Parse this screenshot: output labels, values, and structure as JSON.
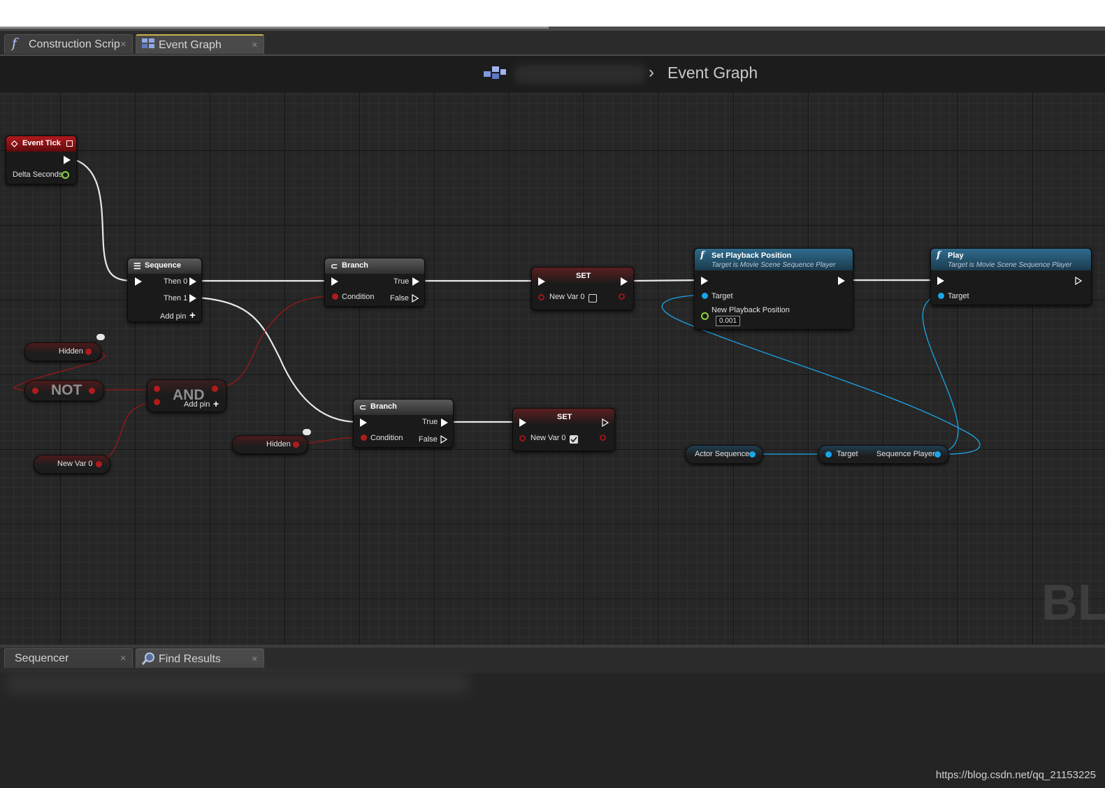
{
  "tabs": [
    {
      "label": "Construction Scrip",
      "icon": "function-icon"
    },
    {
      "label": "Event Graph",
      "icon": "event-graph-icon"
    }
  ],
  "breadcrumb": {
    "current": "Event Graph"
  },
  "nodes": {
    "event_tick": {
      "title": "Event Tick",
      "delta": "Delta Seconds"
    },
    "sequence": {
      "title": "Sequence",
      "then0": "Then 0",
      "then1": "Then 1",
      "add_pin": "Add pin"
    },
    "branch1": {
      "title": "Branch",
      "cond": "Condition",
      "true": "True",
      "false": "False"
    },
    "branch2": {
      "title": "Branch",
      "cond": "Condition",
      "true": "True",
      "false": "False"
    },
    "set1": {
      "title": "SET",
      "var": "New Var 0",
      "checked": false
    },
    "set2": {
      "title": "SET",
      "var": "New Var 0",
      "checked": true
    },
    "set_playback": {
      "title": "Set Playback Position",
      "subtitle": "Target is Movie Scene Sequence Player",
      "target": "Target",
      "new_pos": "New Playback Position",
      "value": "0.001"
    },
    "play": {
      "title": "Play",
      "subtitle": "Target is Movie Scene Sequence Player",
      "target": "Target"
    },
    "hidden1": {
      "label": "Hidden"
    },
    "hidden2": {
      "label": "Hidden"
    },
    "not_op": {
      "label": "NOT"
    },
    "and_op": {
      "label": "AND",
      "add_pin": "Add pin"
    },
    "newvar": {
      "label": "New Var 0"
    },
    "actor_seq": {
      "label": "Actor Sequence"
    },
    "seq_player": {
      "target": "Target",
      "output": "Sequence Player"
    }
  },
  "watermark": "BLU",
  "bottom_tabs": [
    {
      "label": "Sequencer"
    },
    {
      "label": "Find Results",
      "icon": "search-icon"
    }
  ],
  "footer_url": "https://blog.csdn.net/qq_21153225",
  "colors": {
    "exec": "#ffffff",
    "bool": "#a01818",
    "object": "#1aa5e8",
    "float": "#8cd43a"
  }
}
